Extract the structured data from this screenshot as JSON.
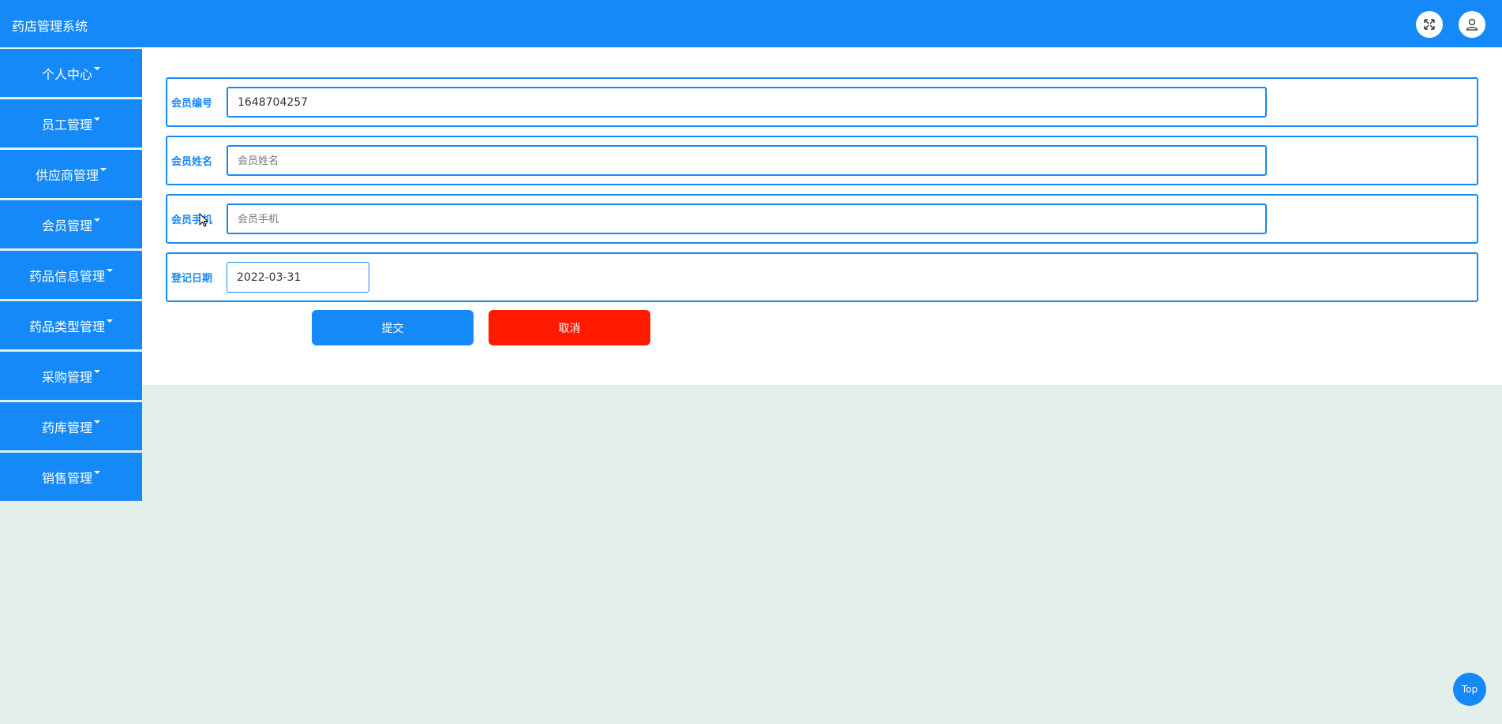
{
  "app": {
    "title": "药店管理系统"
  },
  "header": {
    "icons": [
      "fullscreen-icon",
      "user-icon"
    ]
  },
  "sidebar": {
    "items": [
      {
        "label": "个人中心"
      },
      {
        "label": "员工管理"
      },
      {
        "label": "供应商管理"
      },
      {
        "label": "会员管理"
      },
      {
        "label": "药品信息管理"
      },
      {
        "label": "药品类型管理"
      },
      {
        "label": "采购管理"
      },
      {
        "label": "药库管理"
      },
      {
        "label": "销售管理"
      }
    ]
  },
  "form": {
    "member_id": {
      "label": "会员编号",
      "value": "1648704257"
    },
    "member_name": {
      "label": "会员姓名",
      "placeholder": "会员姓名",
      "value": ""
    },
    "member_phone": {
      "label": "会员手机",
      "placeholder": "会员手机",
      "value": ""
    },
    "register_date": {
      "label": "登记日期",
      "value": "2022-03-31"
    },
    "submit_label": "提交",
    "cancel_label": "取消"
  },
  "back_to_top": {
    "label": "Top"
  },
  "colors": {
    "primary": "#1589f8",
    "danger": "#ff1a00",
    "background": "#e2efea"
  }
}
